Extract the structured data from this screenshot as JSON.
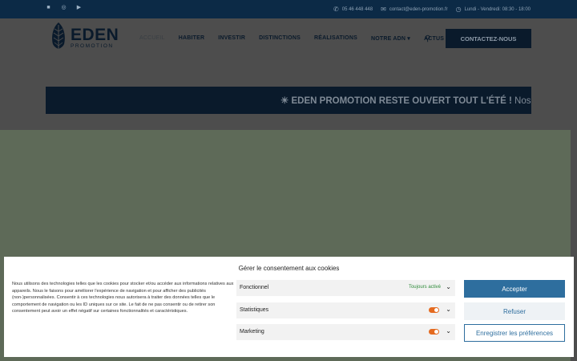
{
  "topbar": {
    "social": [
      {
        "icon": "facebook-icon",
        "glyph": "■"
      },
      {
        "icon": "instagram-icon",
        "glyph": "◎"
      },
      {
        "icon": "youtube-icon",
        "glyph": "▶"
      }
    ],
    "phone": "05 46 448 448",
    "email": "contact@eden-promotion.fr",
    "hours": "Lundi - Vendredi: 08:30 - 18:00"
  },
  "header": {
    "logo_name": "EDEN",
    "logo_sub": "PROMOTION",
    "nav": [
      {
        "label": "ACCUEIL",
        "active": true
      },
      {
        "label": "HABITER"
      },
      {
        "label": "INVESTIR"
      },
      {
        "label": "DISTINCTIONS"
      },
      {
        "label": "RÉALISATIONS"
      },
      {
        "label": "NOTRE ADN ▾"
      },
      {
        "label": "ACTUS ▾"
      }
    ],
    "contact_button": "CONTACTEZ-NOUS"
  },
  "banner": {
    "bold": "☀ EDEN PROMOTION RESTE OUVERT TOUT L'ÉTÉ !",
    "rest": " Nos équipes"
  },
  "cookie": {
    "title": "Gérer le consentement aux cookies",
    "description": "Nous utilisons des technologies telles que les cookies pour stocker et/ou accéder aux informations relatives aux appareils. Nous le faisons pour améliorer l'expérience de navigation et pour afficher des publicités (non-)personnalisées. Consentir à ces technologies nous autorisera à traiter des données telles que le comportement de navigation ou les ID uniques sur ce site. Le fait de ne pas consentir ou de retirer son consentement peut avoir un effet négatif sur certaines fonctionnalités et caractéristiques.",
    "categories": [
      {
        "label": "Fonctionnel",
        "status": "Toujours activé"
      },
      {
        "label": "Statistiques"
      },
      {
        "label": "Marketing"
      }
    ],
    "accept": "Accepter",
    "refuse": "Refuser",
    "preferences": "Enregistrer les préférences"
  },
  "colors": {
    "topbar": "#0c2a46",
    "accent": "#2e6e9e",
    "toggle": "#e46a1f"
  }
}
